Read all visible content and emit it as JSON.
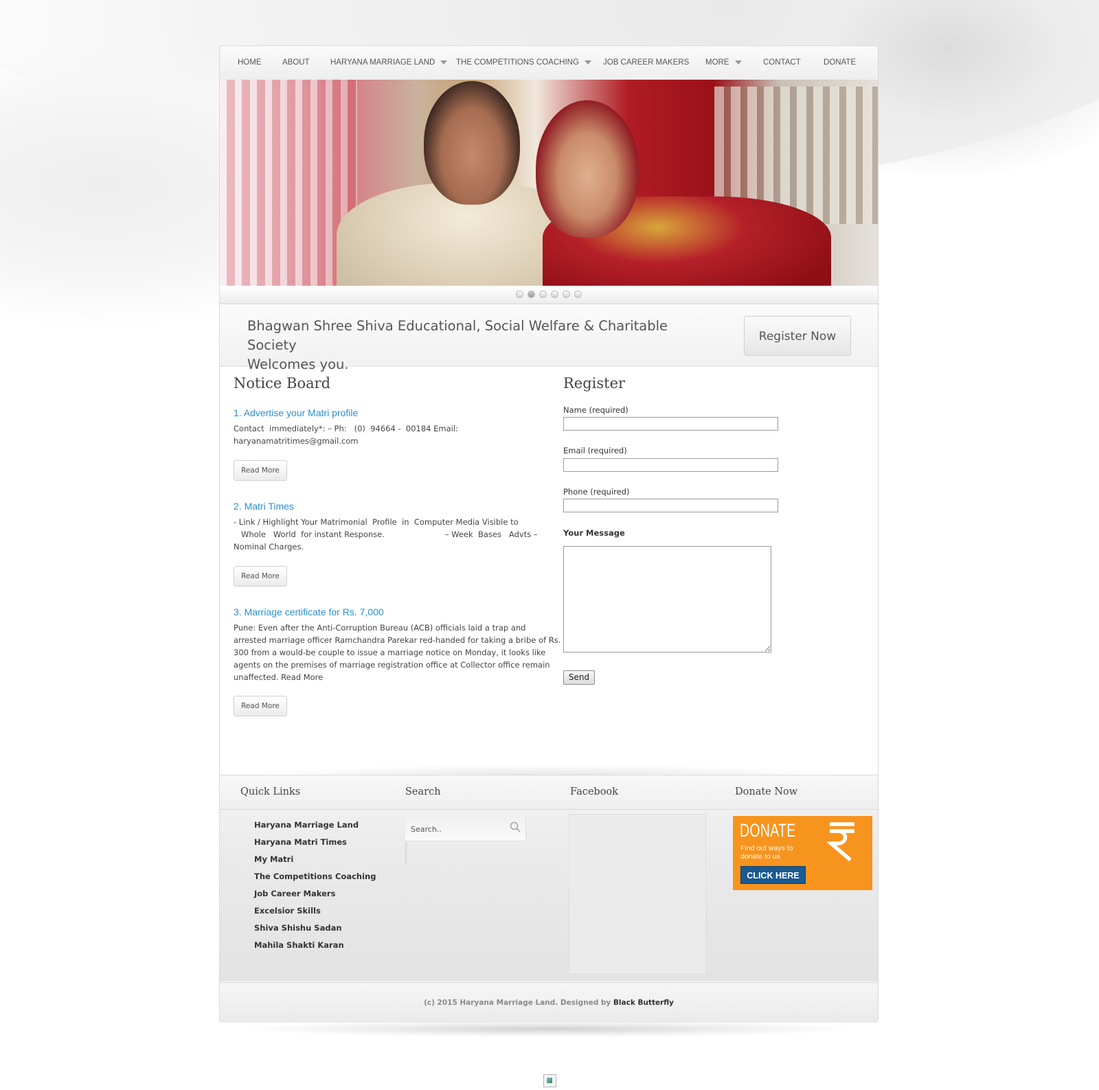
{
  "nav": {
    "items": [
      {
        "label": "HOME",
        "dropdown": false
      },
      {
        "label": "ABOUT",
        "dropdown": false
      },
      {
        "label": "HARYANA MARRIAGE LAND",
        "dropdown": true
      },
      {
        "label": "THE COMPETITIONS COACHING",
        "dropdown": true
      },
      {
        "label": "JOB CAREER MAKERS",
        "dropdown": false
      },
      {
        "label": "MORE",
        "dropdown": true
      },
      {
        "label": "CONTACT",
        "dropdown": false
      },
      {
        "label": "DONATE",
        "dropdown": false
      }
    ]
  },
  "slider": {
    "dot_count": 6,
    "active_index": 1
  },
  "welcome": {
    "line1": "Bhagwan Shree Shiva Educational, Social Welfare & Charitable Society",
    "line2": "Welcomes you.",
    "register_button": "Register Now"
  },
  "notice_board": {
    "title": "Notice Board",
    "items": [
      {
        "title": "1. Advertise your Matri profile",
        "body_lines": [
          "Contact  immediately*: – Ph:   (0)  94664 -  00184 Email:",
          "haryanamatritimes@gmail.com"
        ],
        "read_more": "Read More"
      },
      {
        "title": "2. Matri Times",
        "body_lines": [
          "- Link / Highlight Your Matrimonial  Profile  in  Computer Media Visible to",
          "   Whole   World  for instant Response.                        – Week  Bases   Advts –",
          "Nominal  Charges."
        ],
        "read_more": "Read More"
      },
      {
        "title": "3. Marriage certificate for Rs. 7,000",
        "body_lines": [
          "Pune: Even after the Anti-Corruption Bureau (ACB) officials laid a trap and",
          "arrested marriage officer Ramchandra Parekar red-handed for taking a bribe of Rs.",
          "300 from a would-be couple to issue a marriage notice on Monday, it looks like",
          "agents on the premises of marriage registration office at Collector office remain",
          "unaffected. Read More"
        ],
        "read_more": "Read More"
      }
    ]
  },
  "register": {
    "title": "Register",
    "name_label": "Name (required)",
    "email_label": "Email (required)",
    "phone_label": "Phone (required)",
    "message_label": "Your Message",
    "send_label": "Send"
  },
  "footer": {
    "quick_links_title": "Quick Links",
    "quick_links": [
      "Haryana Marriage Land",
      "Haryana Matri Times",
      "My Matri",
      "The Competitions Coaching",
      "Job Career Makers",
      "Excelsior Skills",
      "Shiva Shishu Sadan",
      "Mahila Shakti Karan"
    ],
    "search_title": "Search",
    "search_placeholder": "Search..",
    "facebook_title": "Facebook",
    "donate_title": "Donate Now",
    "donate_banner": {
      "word": "DONATE",
      "sub": "Find out ways to donate to us",
      "button": "CLICK HERE"
    }
  },
  "copyright": {
    "text": "(c) 2015 Haryana Marriage Land. Designed by",
    "designer": "Black Butterfly"
  },
  "colors": {
    "link_blue": "#2a8fcf",
    "donate_orange": "#f7941d",
    "donate_button_blue": "#1a5a92"
  }
}
